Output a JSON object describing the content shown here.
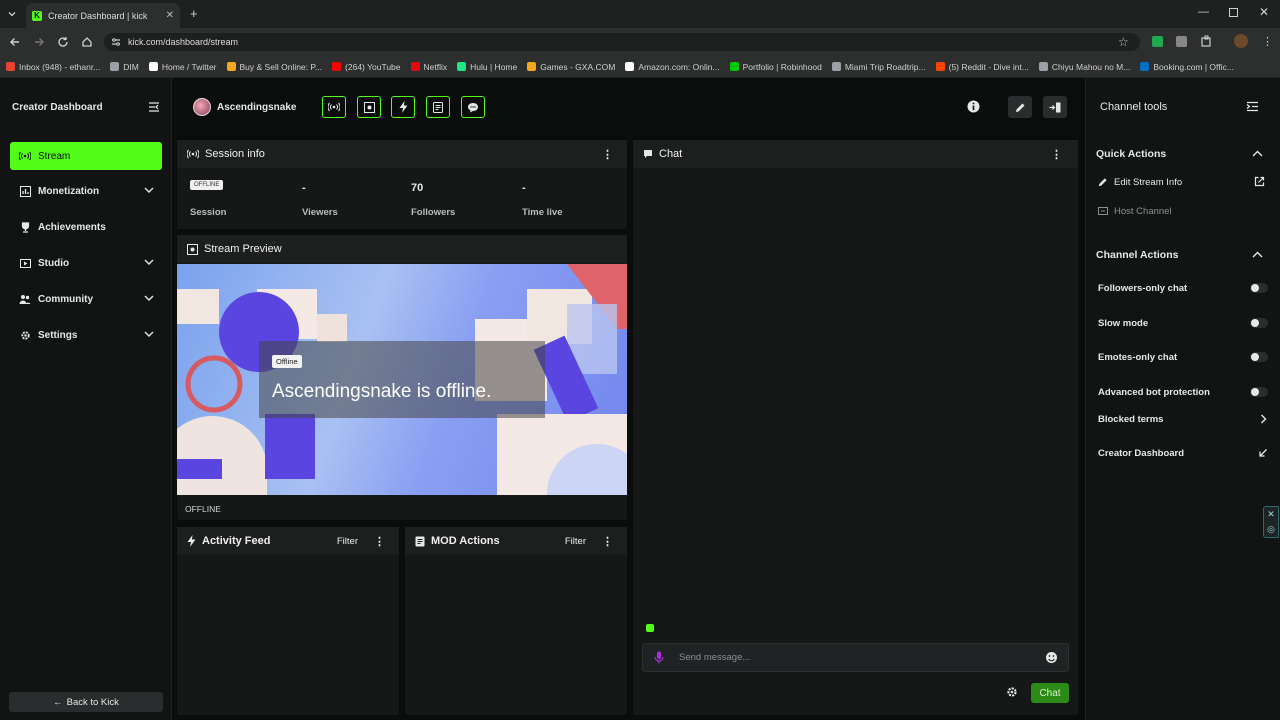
{
  "browser": {
    "tab_title": "Creator Dashboard | kick",
    "url": "kick.com/dashboard/stream",
    "bookmarks": [
      {
        "label": "Inbox (948) - ethanr...",
        "color": "#ea4335"
      },
      {
        "label": "DIM",
        "color": "#9aa0a6"
      },
      {
        "label": "Home / Twitter",
        "color": "#ffffff"
      },
      {
        "label": "Buy & Sell Online: P...",
        "color": "#f5a623"
      },
      {
        "label": "(264) YouTube",
        "color": "#ff0000"
      },
      {
        "label": "Netflix",
        "color": "#e50914"
      },
      {
        "label": "Hulu | Home",
        "color": "#1ce783"
      },
      {
        "label": "Games - GXA.COM",
        "color": "#f5a623"
      },
      {
        "label": "Amazon.com: Onlin...",
        "color": "#ffffff"
      },
      {
        "label": "Portfolio | Robinhood",
        "color": "#00c805"
      },
      {
        "label": "Miami Trip Roadtrip...",
        "color": "#9aa0a6"
      },
      {
        "label": "(5) Reddit - Dive int...",
        "color": "#ff4500"
      },
      {
        "label": "Chiyu Mahou no M...",
        "color": "#9aa0a6"
      },
      {
        "label": "Booking.com | Offic...",
        "color": "#0071c2"
      }
    ]
  },
  "sidebar": {
    "title": "Creator Dashboard",
    "items": [
      {
        "label": "Stream",
        "active": true
      },
      {
        "label": "Monetization"
      },
      {
        "label": "Achievements"
      },
      {
        "label": "Studio"
      },
      {
        "label": "Community"
      },
      {
        "label": "Settings"
      }
    ],
    "back_label": "Back to Kick"
  },
  "topbar": {
    "username": "Ascendingsnake"
  },
  "session_info": {
    "title": "Session info",
    "stats": [
      {
        "value": "OFFLINE",
        "label": "Session"
      },
      {
        "value": "-",
        "label": "Viewers"
      },
      {
        "value": "70",
        "label": "Followers"
      },
      {
        "value": "-",
        "label": "Time live"
      }
    ]
  },
  "stream_preview": {
    "title": "Stream Preview",
    "badge": "Offline",
    "message": "Ascendingsnake is offline.",
    "status": "OFFLINE"
  },
  "activity_feed": {
    "title": "Activity Feed",
    "filter": "Filter"
  },
  "mod_actions": {
    "title": "MOD Actions",
    "filter": "Filter"
  },
  "chat": {
    "title": "Chat",
    "input_placeholder": "Send message...",
    "send_label": "Chat"
  },
  "channel_tools": {
    "title": "Channel tools",
    "quick_actions": {
      "title": "Quick Actions",
      "items": [
        "Edit Stream Info",
        "Host Channel"
      ]
    },
    "channel_actions": {
      "title": "Channel Actions",
      "toggles": [
        "Followers-only chat",
        "Slow mode",
        "Emotes-only chat",
        "Advanced bot protection"
      ],
      "links": [
        "Blocked terms",
        "Creator Dashboard"
      ]
    }
  },
  "colors": {
    "accent": "#53fc18",
    "bg": "#0b0d0d",
    "panel": "#161818"
  }
}
